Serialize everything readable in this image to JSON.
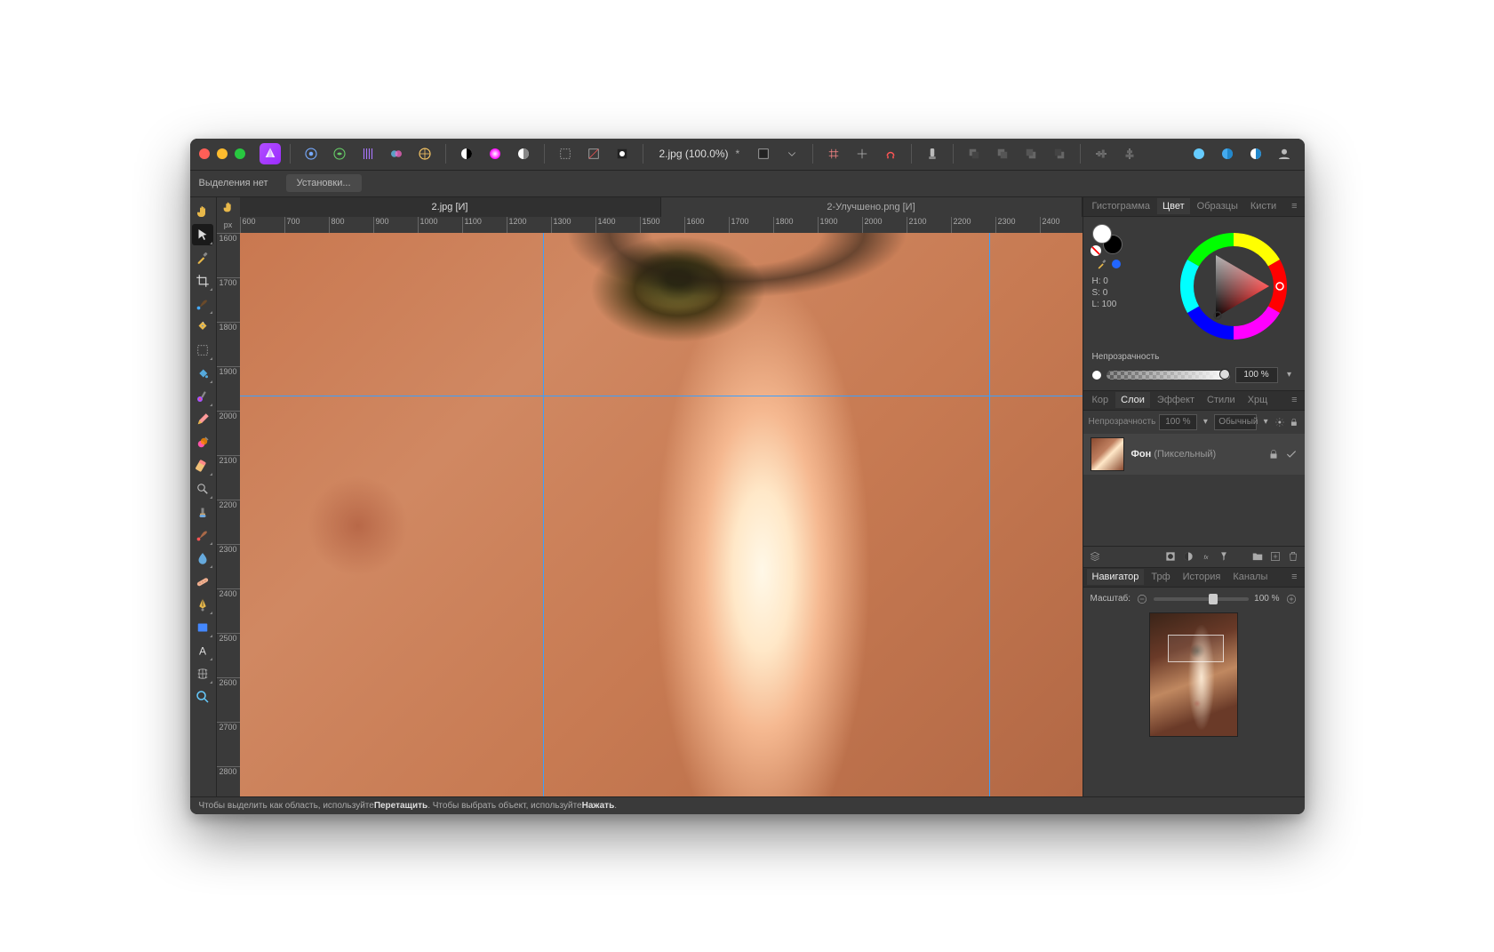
{
  "doc": {
    "title": "2.jpg (100.0%)",
    "modified": "*"
  },
  "contextbar": {
    "selection": "Выделения нет",
    "presets": "Установки..."
  },
  "doctabs": [
    {
      "label": "2.jpg  [И]",
      "active": true
    },
    {
      "label": "2-Улучшено.png  [И]",
      "active": false
    }
  ],
  "ruler": {
    "unit": "px",
    "h": [
      "600",
      "700",
      "800",
      "900",
      "1000",
      "1100",
      "1200",
      "1300",
      "1400",
      "1500",
      "1600",
      "1700",
      "1800",
      "1900",
      "2000",
      "2100",
      "2200",
      "2300",
      "2400"
    ],
    "v": [
      "1600",
      "1700",
      "1800",
      "1900",
      "2000",
      "2100",
      "2200",
      "2300",
      "2400",
      "2500",
      "2600",
      "2700",
      "2800"
    ]
  },
  "guides": {
    "v": [
      36,
      89
    ],
    "h": [
      29
    ]
  },
  "panels": {
    "color": {
      "tabs": [
        "Гистограмма",
        "Цвет",
        "Образцы",
        "Кисти"
      ],
      "active": 1,
      "hsl": {
        "h": "H: 0",
        "s": "S: 0",
        "l": "L: 100"
      },
      "opacity_label": "Непрозрачность",
      "opacity_value": "100 %"
    },
    "layers": {
      "tabs": [
        "Кор",
        "Слои",
        "Эффект",
        "Стили",
        "Хрщ"
      ],
      "active": 1,
      "opacity_label": "Непрозрачность",
      "opacity_value": "100 %",
      "blend": "Обычный",
      "items": [
        {
          "name": "Фон",
          "type": "(Пиксельный)",
          "locked": true,
          "visible": true
        }
      ]
    },
    "navigator": {
      "tabs": [
        "Навигатор",
        "Трф",
        "История",
        "Каналы"
      ],
      "active": 0,
      "zoom_label": "Масштаб:",
      "zoom_value": "100 %"
    }
  },
  "status": {
    "prefix": "Чтобы выделить как область, используйте ",
    "drag": "Перетащить",
    "mid": ". Чтобы выбрать объект, используйте ",
    "click": "Нажать",
    "suffix": "."
  }
}
